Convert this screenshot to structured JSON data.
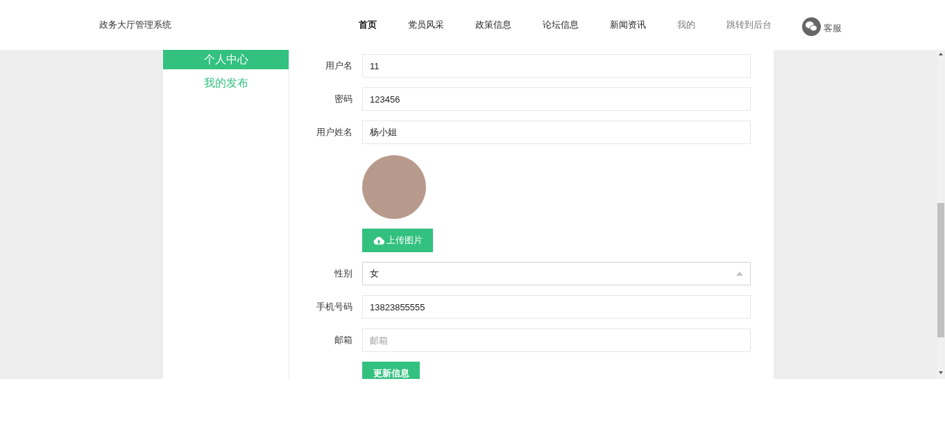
{
  "header": {
    "title": "政务大厅管理系统",
    "nav": [
      {
        "label": "首页",
        "selected": true,
        "muted": false
      },
      {
        "label": "党员风采",
        "selected": false,
        "muted": false
      },
      {
        "label": "政策信息",
        "selected": false,
        "muted": false
      },
      {
        "label": "论坛信息",
        "selected": false,
        "muted": false
      },
      {
        "label": "新闻资讯",
        "selected": false,
        "muted": false
      },
      {
        "label": "我的",
        "selected": false,
        "muted": true
      },
      {
        "label": "跳转到后台",
        "selected": false,
        "muted": true
      }
    ],
    "service": "客服"
  },
  "sidebar": {
    "items": [
      {
        "label": "个人中心",
        "selected": true
      },
      {
        "label": "我的发布",
        "selected": false
      }
    ]
  },
  "form": {
    "fields": [
      {
        "kind": "text",
        "label": "用户名",
        "value": "11"
      },
      {
        "kind": "text",
        "label": "密码",
        "value": "123456"
      },
      {
        "kind": "text",
        "label": "用户姓名",
        "value": "杨小姐"
      },
      {
        "kind": "avatar",
        "button": "上传图片"
      },
      {
        "kind": "select",
        "label": "性别",
        "value": "女"
      },
      {
        "kind": "text",
        "label": "手机号码",
        "value": "13823855555"
      },
      {
        "kind": "text",
        "label": "邮箱",
        "placeholder": "邮箱"
      }
    ],
    "submit": "更新信息"
  }
}
